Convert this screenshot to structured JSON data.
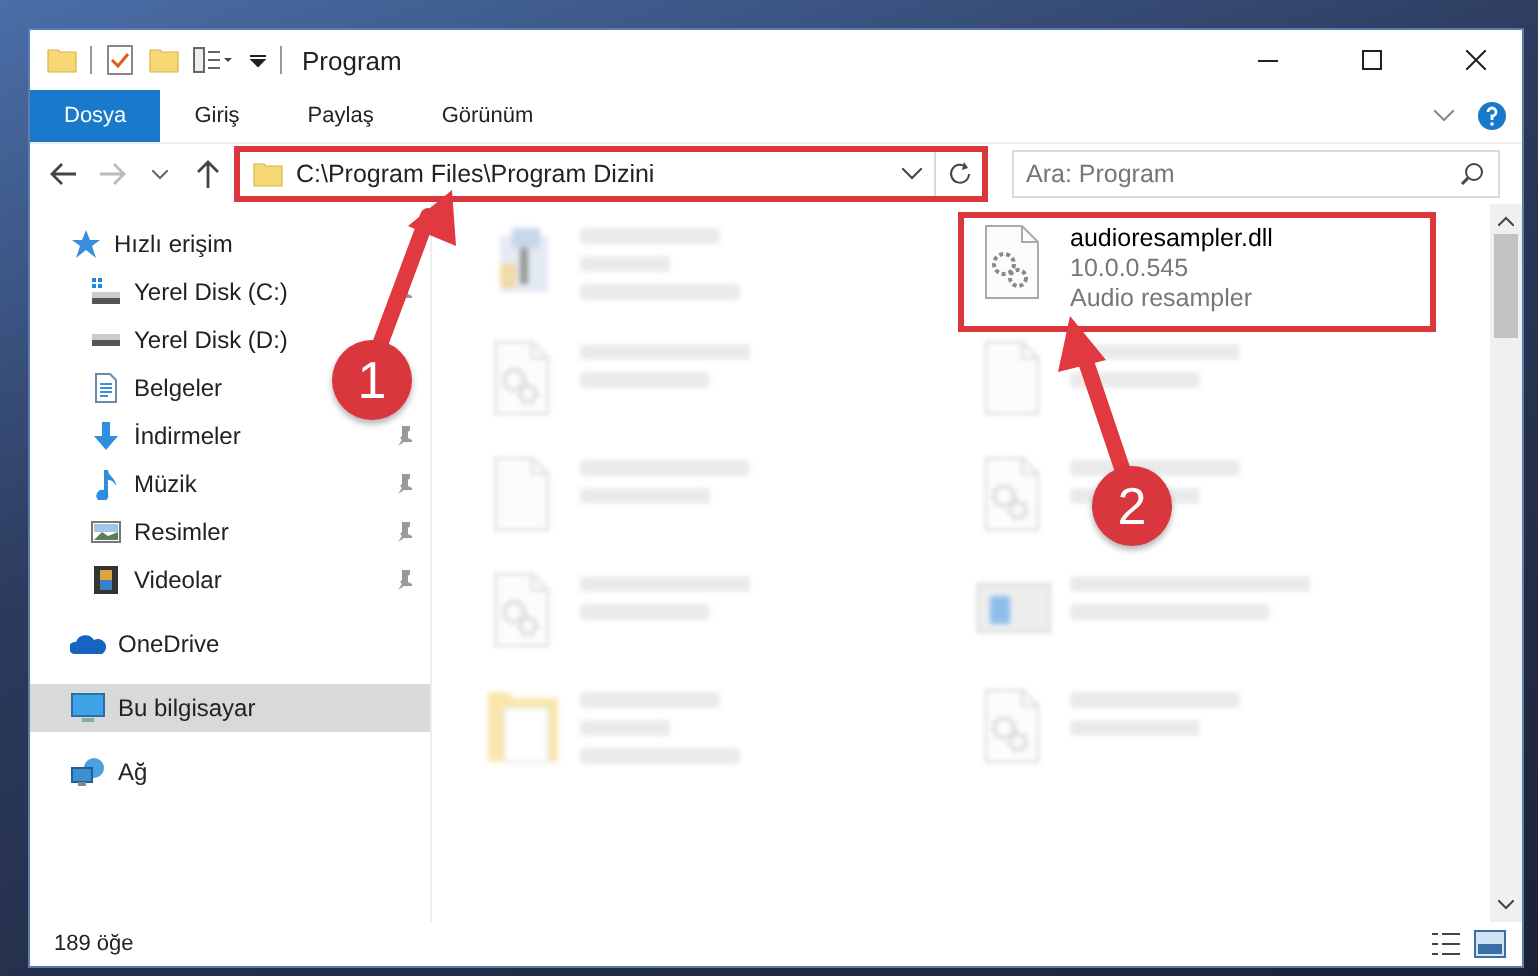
{
  "window": {
    "title": "Program"
  },
  "ribbon_tabs": [
    {
      "label": "Dosya",
      "selected": true
    },
    {
      "label": "Giriş",
      "selected": false
    },
    {
      "label": "Paylaş",
      "selected": false
    },
    {
      "label": "Görünüm",
      "selected": false
    }
  ],
  "address": {
    "path": "C:\\Program Files\\Program Dizini",
    "highlighted": true
  },
  "search": {
    "placeholder": "Ara: Program"
  },
  "sidebar": {
    "items": [
      {
        "label": "Hızlı erişim",
        "kind": "star",
        "selected": false,
        "children": [
          {
            "label": "Yerel Disk (C:)",
            "kind": "drive-c",
            "pinned": true,
            "selected": false
          },
          {
            "label": "Yerel Disk (D:)",
            "kind": "drive",
            "pinned": false,
            "selected": false
          },
          {
            "label": "Belgeler",
            "kind": "docs",
            "pinned": false,
            "selected": false
          },
          {
            "label": "İndirmeler",
            "kind": "download",
            "pinned": true,
            "selected": false
          },
          {
            "label": "Müzik",
            "kind": "music",
            "pinned": true,
            "selected": false
          },
          {
            "label": "Resimler",
            "kind": "pictures",
            "pinned": true,
            "selected": false
          },
          {
            "label": "Videolar",
            "kind": "video",
            "pinned": true,
            "selected": false
          }
        ]
      },
      {
        "label": "OneDrive",
        "kind": "cloud",
        "selected": false
      },
      {
        "label": "Bu bilgisayar",
        "kind": "pc",
        "selected": true
      },
      {
        "label": "Ağ",
        "kind": "network",
        "selected": false
      }
    ]
  },
  "files": [
    {
      "kind": "exe",
      "blurred": true,
      "highlighted": false
    },
    {
      "name": "audioresampler.dll",
      "details": [
        "10.0.0.545",
        "Audio resampler"
      ],
      "kind": "dll",
      "blurred": false,
      "highlighted": true
    },
    {
      "kind": "dll",
      "blurred": true,
      "highlighted": false
    },
    {
      "kind": "file",
      "blurred": true,
      "highlighted": false
    },
    {
      "kind": "file",
      "blurred": true,
      "highlighted": false
    },
    {
      "kind": "dll",
      "blurred": true,
      "highlighted": false
    },
    {
      "kind": "dll",
      "blurred": true,
      "highlighted": false
    },
    {
      "kind": "app",
      "blurred": true,
      "highlighted": false
    },
    {
      "kind": "folder",
      "blurred": true,
      "highlighted": false
    },
    {
      "kind": "dll",
      "blurred": true,
      "highlighted": false
    }
  ],
  "status_bar": {
    "count": "189 öğe"
  },
  "annotations": [
    {
      "number": "1"
    },
    {
      "number": "2"
    }
  ]
}
